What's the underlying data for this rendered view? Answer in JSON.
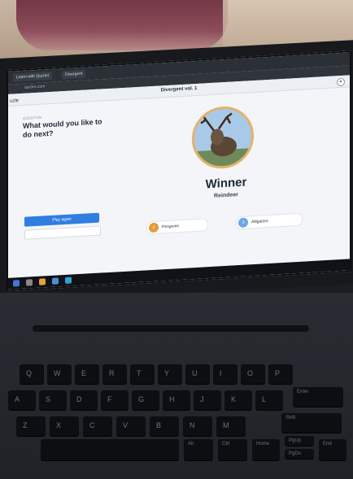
{
  "browser": {
    "tabs": [
      "Learn with Quizlet",
      "Divergent"
    ]
  },
  "app": {
    "title": "Divergent vol. 1",
    "close_label": "×",
    "side_word": "uzle"
  },
  "left_panel": {
    "label": "QUESTION",
    "question": "What would you like to do next?",
    "play_again": "Play again"
  },
  "winner_panel": {
    "winner_label": "Winner",
    "winner_name": "Reindeer",
    "pills": [
      {
        "num": "2",
        "label": "Penguins",
        "color": "#e39a3a"
      },
      {
        "num": "3",
        "label": "Alligators",
        "color": "#6aa7e6"
      }
    ]
  },
  "keyboard": {
    "row2": [
      "Q",
      "W",
      "E",
      "R",
      "T",
      "Y",
      "U",
      "I",
      "O",
      "P"
    ],
    "row3": [
      "A",
      "S",
      "D",
      "F",
      "G",
      "H",
      "J",
      "K",
      "L"
    ],
    "row4": [
      "Z",
      "X",
      "C",
      "V",
      "B",
      "N",
      "M"
    ],
    "special": [
      "Enter",
      "Shift",
      "Alt",
      "Ctrl",
      "Home",
      "End",
      "PgUp",
      "PgDn"
    ]
  }
}
